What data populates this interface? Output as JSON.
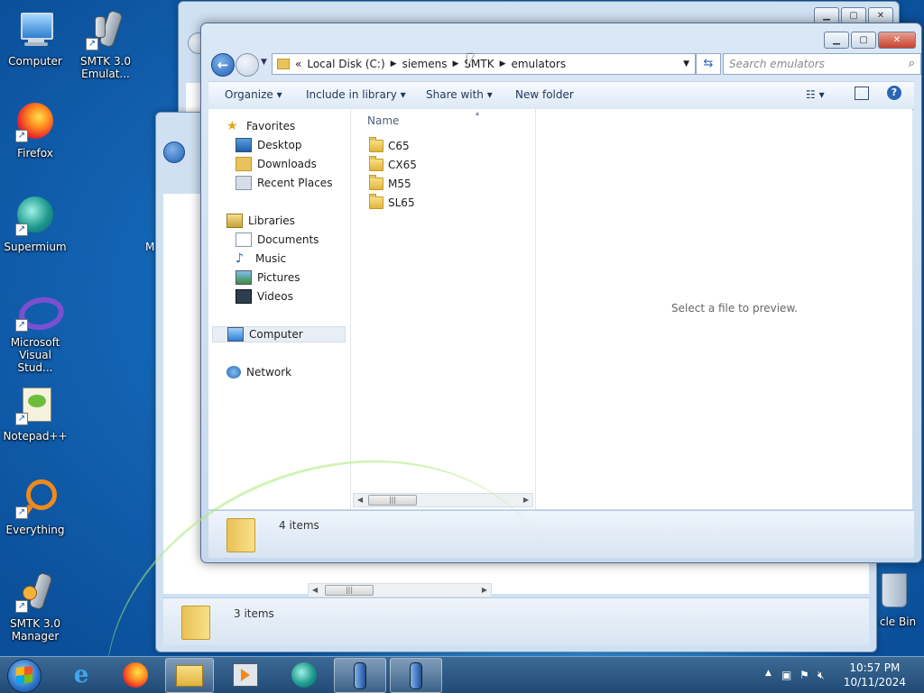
{
  "desktop": {
    "icons": [
      {
        "label": "Computer"
      },
      {
        "label": "SMTK 3.0 Emulat..."
      },
      {
        "label": "Firefox"
      },
      {
        "label": "Supermium"
      },
      {
        "label": "Microsoft Visual Stud..."
      },
      {
        "label": "Notepad++"
      },
      {
        "label": "Everything"
      },
      {
        "label": "SMTK 3.0 Manager"
      },
      {
        "label": "cle Bin"
      }
    ]
  },
  "back_window": {
    "partial_label": "M",
    "status": "3 items"
  },
  "explorer": {
    "address": {
      "chevron": "«",
      "parts": [
        "Local Disk (C:)",
        "siemens",
        "SMTK",
        "emulators"
      ]
    },
    "search_placeholder": "Search emulators",
    "toolbar": {
      "organize": "Organize ▾",
      "include": "Include in library ▾",
      "share": "Share with ▾",
      "newfolder": "New folder"
    },
    "nav": {
      "favorites": "Favorites",
      "desktop": "Desktop",
      "downloads": "Downloads",
      "recent": "Recent Places",
      "libraries": "Libraries",
      "documents": "Documents",
      "music": "Music",
      "pictures": "Pictures",
      "videos": "Videos",
      "computer": "Computer",
      "network": "Network"
    },
    "column_name": "Name",
    "files": [
      "C65",
      "CX65",
      "M55",
      "SL65"
    ],
    "preview_text": "Select a file to preview.",
    "status": "4 items"
  },
  "taskbar": {
    "time": "10:57 PM",
    "date": "10/11/2024"
  },
  "colors": {
    "accent": "#1f5fb5",
    "taskbar": "#1f4a75",
    "folder": "#e8c25a"
  }
}
